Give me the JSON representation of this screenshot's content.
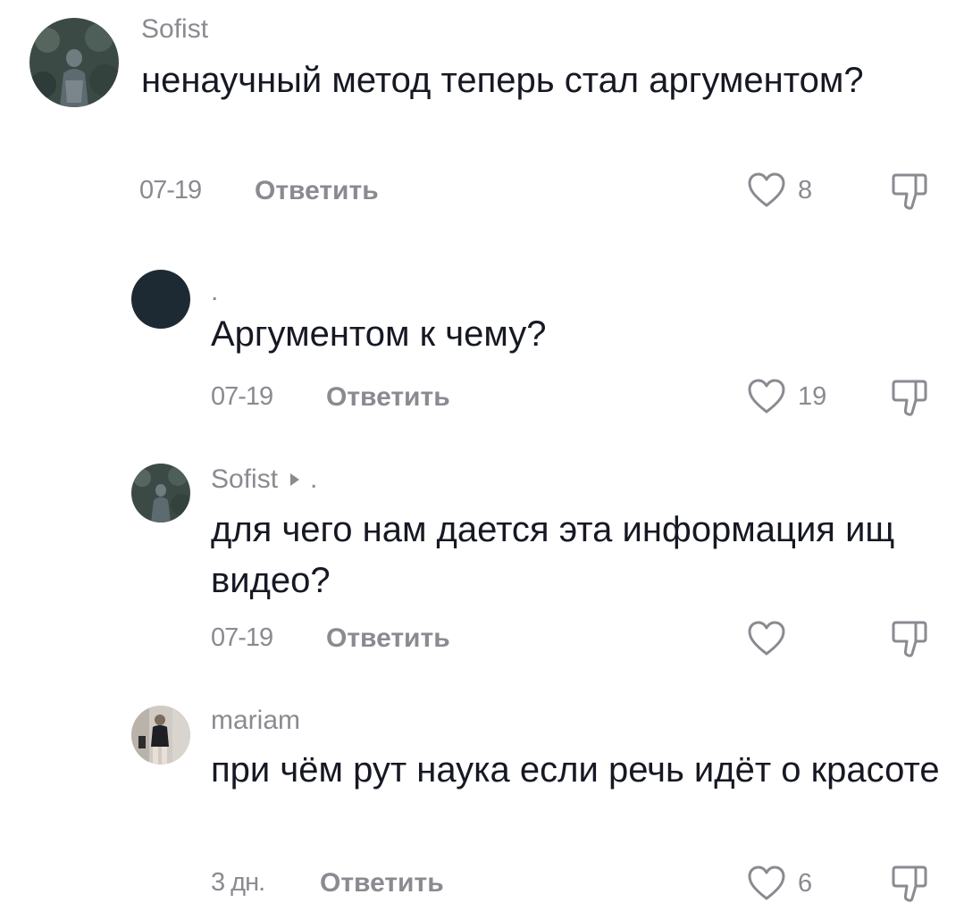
{
  "comments": [
    {
      "username": "Sofist",
      "reply_to": "",
      "text": "ненаучный метод теперь стал аргументом?",
      "date": "07-19",
      "reply_label": "Ответить",
      "likes": "8"
    },
    {
      "username": ".",
      "reply_to": "",
      "text": "Аргументом к чему?",
      "date": "07-19",
      "reply_label": "Ответить",
      "likes": "19"
    },
    {
      "username": "Sofist",
      "reply_to": ".",
      "text": "для чего нам дается эта информация ищ видео?",
      "date": "07-19",
      "reply_label": "Ответить",
      "likes": ""
    },
    {
      "username": "mariam",
      "reply_to": "",
      "text": "при чём рут наука если речь идёт о красоте",
      "date": "3 дн.",
      "reply_label": "Ответить",
      "likes": "6"
    }
  ],
  "icons": {
    "like": "heart-outline-icon",
    "dislike": "thumbs-down-icon"
  },
  "colors": {
    "text": "#161823",
    "secondary": "#8a8b91",
    "avatar_dark": "#1e2a33"
  }
}
